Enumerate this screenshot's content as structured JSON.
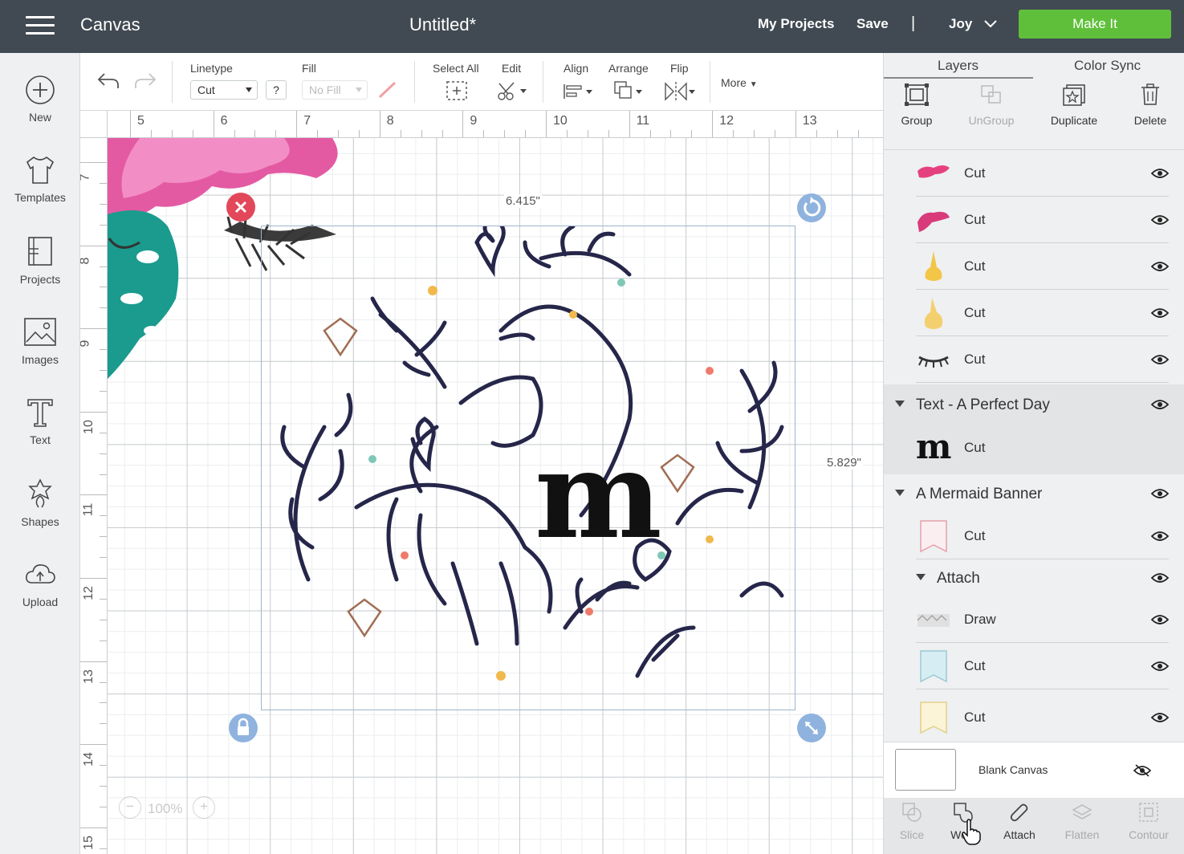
{
  "header": {
    "app_title": "Canvas",
    "doc_title": "Untitled*",
    "my_projects": "My Projects",
    "save": "Save",
    "separator": "|",
    "user": "Joy",
    "make_it": "Make It"
  },
  "sidebar": {
    "items": [
      {
        "label": "New",
        "icon": "plus-circle-icon"
      },
      {
        "label": "Templates",
        "icon": "tshirt-icon"
      },
      {
        "label": "Projects",
        "icon": "projects-icon"
      },
      {
        "label": "Images",
        "icon": "image-icon"
      },
      {
        "label": "Text",
        "icon": "text-icon"
      },
      {
        "label": "Shapes",
        "icon": "shapes-icon"
      },
      {
        "label": "Upload",
        "icon": "upload-cloud-icon"
      }
    ]
  },
  "toolbar": {
    "linetype_label": "Linetype",
    "linetype_value": "Cut",
    "help": "?",
    "fill_label": "Fill",
    "fill_value": "No Fill",
    "select_all": "Select All",
    "edit": "Edit",
    "align": "Align",
    "arrange": "Arrange",
    "flip": "Flip",
    "more": "More"
  },
  "rulers": {
    "top": [
      "5",
      "6",
      "7",
      "8",
      "9",
      "10",
      "11",
      "12",
      "13"
    ],
    "left": [
      "7",
      "8",
      "9",
      "10",
      "11",
      "12",
      "13",
      "14",
      "15"
    ]
  },
  "canvas": {
    "width_readout": "6.415\"",
    "height_readout": "5.829\"",
    "zoom": "100%",
    "zoom_minus": "−",
    "zoom_plus": "+",
    "letter": "m"
  },
  "panel": {
    "tab_layers": "Layers",
    "tab_color_sync": "Color Sync",
    "actions": [
      "Group",
      "UnGroup",
      "Duplicate",
      "Delete"
    ],
    "layers": [
      {
        "name": "Cut",
        "thumb_color": "#e6417f"
      },
      {
        "name": "Cut",
        "thumb_color": "#d93a7a"
      },
      {
        "name": "Cut",
        "thumb_color": "#f3c648"
      },
      {
        "name": "Cut",
        "thumb_color": "#f4cf6e"
      },
      {
        "name": "Cut",
        "thumb_color": "#333"
      }
    ],
    "group_text": "Text - A Perfect Day",
    "text_layer": "Cut",
    "group_banner": "A Mermaid Banner",
    "banner_layer": "Cut",
    "group_attach": "Attach",
    "attach_layers": [
      {
        "name": "Draw"
      },
      {
        "name": "Cut"
      },
      {
        "name": "Cut"
      }
    ],
    "blank_canvas": "Blank Canvas",
    "bottom": [
      "Slice",
      "Weld",
      "Attach",
      "Flatten",
      "Contour"
    ]
  },
  "colors": {
    "accent_green": "#5fbf3a",
    "header_bg": "#414a52",
    "selection": "#9fb6cc",
    "delete_red": "#e2475a",
    "handle_blue": "#8fb3de"
  }
}
